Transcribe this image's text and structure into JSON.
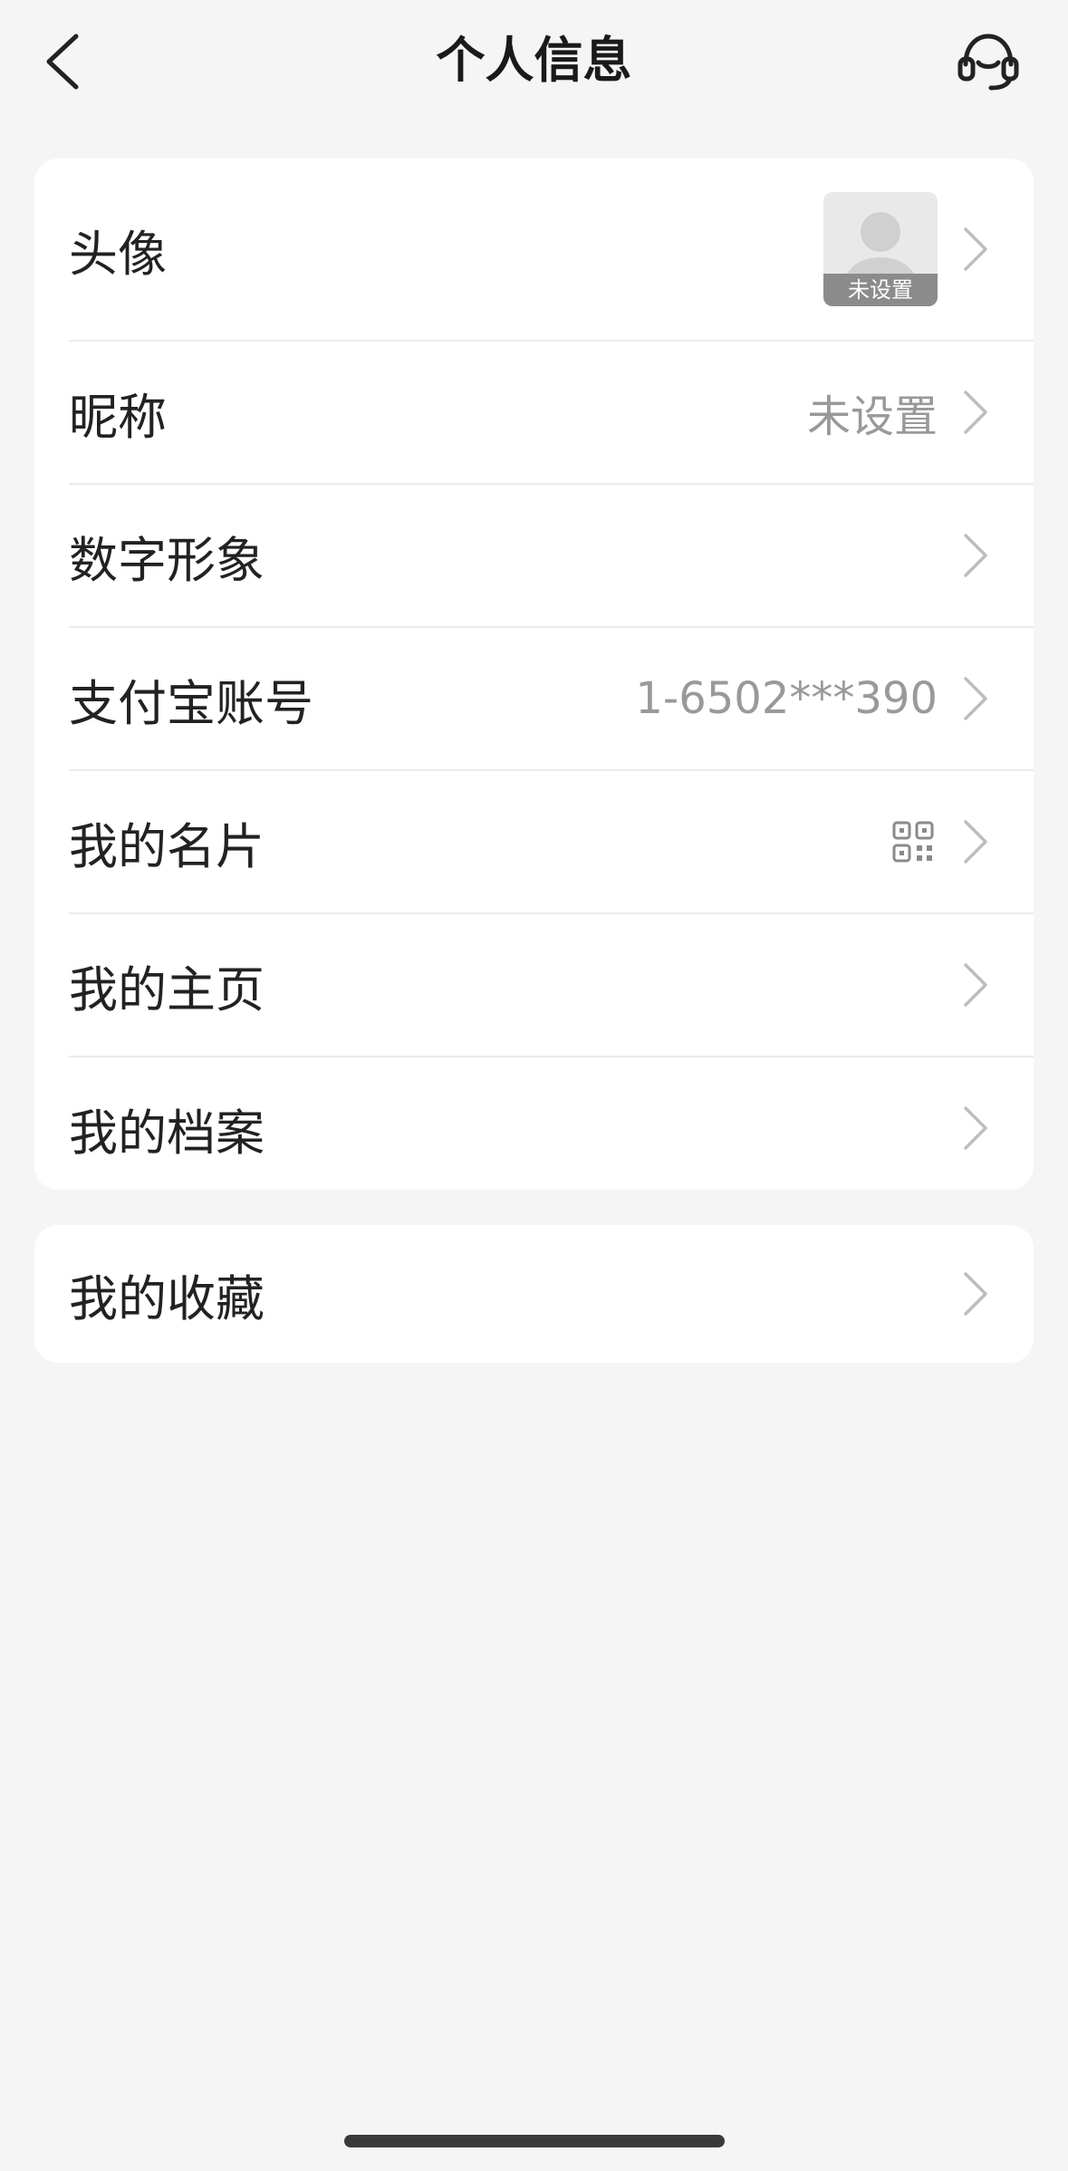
{
  "header": {
    "title": "个人信息",
    "back_icon": "chevron-left-icon",
    "support_icon": "headset-icon"
  },
  "profile_rows": [
    {
      "label": "头像",
      "value": "",
      "avatar_badge": "未设置"
    },
    {
      "label": "昵称",
      "value": "未设置"
    },
    {
      "label": "数字形象",
      "value": ""
    },
    {
      "label": "支付宝账号",
      "value": "1-6502***390"
    },
    {
      "label": "我的名片",
      "value": "",
      "icon": "qr-code-icon"
    },
    {
      "label": "我的主页",
      "value": ""
    },
    {
      "label": "我的档案",
      "value": ""
    }
  ],
  "extra_rows": [
    {
      "label": "我的收藏",
      "value": ""
    }
  ],
  "colors": {
    "background": "#f5f5f5",
    "card": "#ffffff",
    "secondary_text": "#999999",
    "divider": "#ebebeb"
  }
}
